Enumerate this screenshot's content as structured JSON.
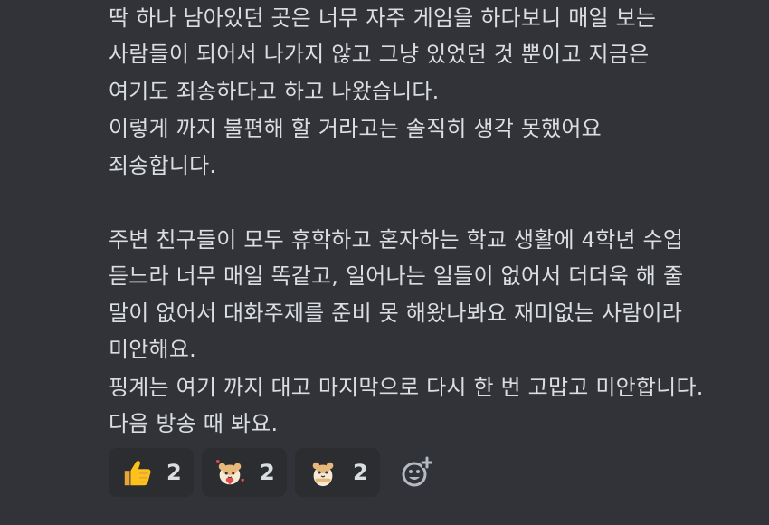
{
  "message": {
    "lines": [
      "딱 하나 남아있던 곳은 너무 자주 게임을 하다보니 매일 보는",
      "사람들이 되어서 나가지 않고 그냥 있었던 것 뿐이고 지금은",
      "여기도 죄송하다고 하고 나왔습니다.",
      "이렇게 까지 불편해 할 거라고는 솔직히 생각 못했어요",
      "죄송합니다.",
      "주변 친구들이 모두 휴학하고 혼자하는 학교 생활에 4학년 수업",
      "듣느라 너무 매일 똑같고, 일어나는 일들이 없어서 더더욱 해 줄",
      "말이 없어서 대화주제를 준비 못 해왔나봐요 재미없는 사람이라",
      "미안해요.",
      "핑계는 여기 까지 대고 마지막으로 다시 한 번 고맙고 미안합니다.",
      "다음 방송 때 봐요."
    ]
  },
  "reactions": [
    {
      "emoji": "thumbs-up-icon",
      "count": "2"
    },
    {
      "emoji": "hamster-heart-icon",
      "count": "2"
    },
    {
      "emoji": "hamster-icon",
      "count": "2"
    }
  ],
  "colors": {
    "background": "#313338",
    "text": "#dbdee1",
    "reaction_bg": "#2b2d31",
    "add_reaction_icon": "#b5bac1"
  },
  "add_reaction": {
    "icon": "smiley-plus-icon"
  }
}
